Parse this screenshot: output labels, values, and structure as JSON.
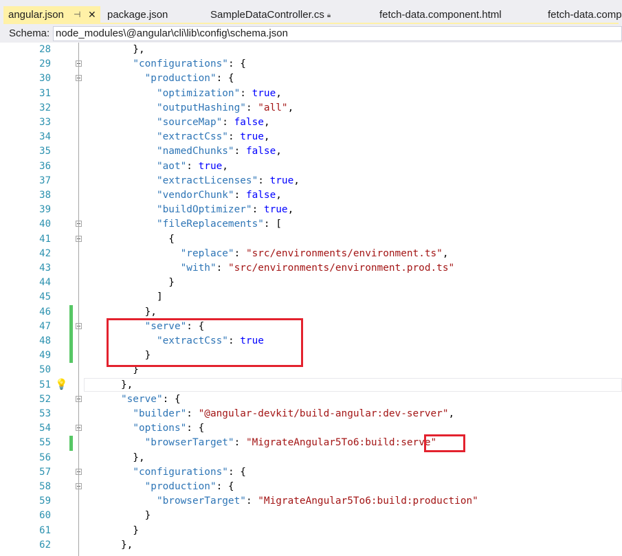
{
  "tabs": [
    {
      "label": "angular.json",
      "active": true
    },
    {
      "label": "package.json"
    },
    {
      "label": "SampleDataController.cs",
      "locked": true
    },
    {
      "label": "fetch-data.component.html"
    },
    {
      "label": "fetch-data.comp"
    }
  ],
  "tab_icons": {
    "pin": "pin-icon",
    "close": "close-icon",
    "lock": "lock-icon"
  },
  "schema": {
    "label": "Schema:",
    "value": "node_modules\\@angular\\cli\\lib\\config\\schema.json"
  },
  "colors": {
    "key": "#2e75b6",
    "string": "#a31515",
    "keyword": "#0000ff",
    "linenum": "#2b91af",
    "changed": "#57c765",
    "highlight": "#e3222e"
  },
  "lines": [
    {
      "n": "28",
      "tokens": [
        [
          "p",
          "        },"
        ]
      ]
    },
    {
      "n": "29",
      "fold": true,
      "tokens": [
        [
          "p",
          "        "
        ],
        [
          "k",
          "\"configurations\""
        ],
        [
          "p",
          ": {"
        ]
      ]
    },
    {
      "n": "30",
      "fold": true,
      "tokens": [
        [
          "p",
          "          "
        ],
        [
          "k",
          "\"production\""
        ],
        [
          "p",
          ": {"
        ]
      ]
    },
    {
      "n": "31",
      "tokens": [
        [
          "p",
          "            "
        ],
        [
          "k",
          "\"optimization\""
        ],
        [
          "p",
          ": "
        ],
        [
          "b",
          "true"
        ],
        [
          "p",
          ","
        ]
      ]
    },
    {
      "n": "32",
      "tokens": [
        [
          "p",
          "            "
        ],
        [
          "k",
          "\"outputHashing\""
        ],
        [
          "p",
          ": "
        ],
        [
          "s",
          "\"all\""
        ],
        [
          "p",
          ","
        ]
      ]
    },
    {
      "n": "33",
      "tokens": [
        [
          "p",
          "            "
        ],
        [
          "k",
          "\"sourceMap\""
        ],
        [
          "p",
          ": "
        ],
        [
          "b",
          "false"
        ],
        [
          "p",
          ","
        ]
      ]
    },
    {
      "n": "34",
      "tokens": [
        [
          "p",
          "            "
        ],
        [
          "k",
          "\"extractCss\""
        ],
        [
          "p",
          ": "
        ],
        [
          "b",
          "true"
        ],
        [
          "p",
          ","
        ]
      ]
    },
    {
      "n": "35",
      "tokens": [
        [
          "p",
          "            "
        ],
        [
          "k",
          "\"namedChunks\""
        ],
        [
          "p",
          ": "
        ],
        [
          "b",
          "false"
        ],
        [
          "p",
          ","
        ]
      ]
    },
    {
      "n": "36",
      "tokens": [
        [
          "p",
          "            "
        ],
        [
          "k",
          "\"aot\""
        ],
        [
          "p",
          ": "
        ],
        [
          "b",
          "true"
        ],
        [
          "p",
          ","
        ]
      ]
    },
    {
      "n": "37",
      "tokens": [
        [
          "p",
          "            "
        ],
        [
          "k",
          "\"extractLicenses\""
        ],
        [
          "p",
          ": "
        ],
        [
          "b",
          "true"
        ],
        [
          "p",
          ","
        ]
      ]
    },
    {
      "n": "38",
      "tokens": [
        [
          "p",
          "            "
        ],
        [
          "k",
          "\"vendorChunk\""
        ],
        [
          "p",
          ": "
        ],
        [
          "b",
          "false"
        ],
        [
          "p",
          ","
        ]
      ]
    },
    {
      "n": "39",
      "tokens": [
        [
          "p",
          "            "
        ],
        [
          "k",
          "\"buildOptimizer\""
        ],
        [
          "p",
          ": "
        ],
        [
          "b",
          "true"
        ],
        [
          "p",
          ","
        ]
      ]
    },
    {
      "n": "40",
      "fold": true,
      "tokens": [
        [
          "p",
          "            "
        ],
        [
          "k",
          "\"fileReplacements\""
        ],
        [
          "p",
          ": ["
        ]
      ]
    },
    {
      "n": "41",
      "fold": true,
      "tokens": [
        [
          "p",
          "              {"
        ]
      ]
    },
    {
      "n": "42",
      "tokens": [
        [
          "p",
          "                "
        ],
        [
          "k",
          "\"replace\""
        ],
        [
          "p",
          ": "
        ],
        [
          "s",
          "\"src/environments/environment.ts\""
        ],
        [
          "p",
          ","
        ]
      ]
    },
    {
      "n": "43",
      "tokens": [
        [
          "p",
          "                "
        ],
        [
          "k",
          "\"with\""
        ],
        [
          "p",
          ": "
        ],
        [
          "s",
          "\"src/environments/environment.prod.ts\""
        ]
      ]
    },
    {
      "n": "44",
      "tokens": [
        [
          "p",
          "              }"
        ]
      ]
    },
    {
      "n": "45",
      "tokens": [
        [
          "p",
          "            ]"
        ]
      ]
    },
    {
      "n": "46",
      "changed": true,
      "tokens": [
        [
          "p",
          "          },"
        ]
      ]
    },
    {
      "n": "47",
      "changed": true,
      "fold": true,
      "tokens": [
        [
          "p",
          "          "
        ],
        [
          "k",
          "\"serve\""
        ],
        [
          "p",
          ": {"
        ]
      ]
    },
    {
      "n": "48",
      "changed": true,
      "tokens": [
        [
          "p",
          "            "
        ],
        [
          "k",
          "\"extractCss\""
        ],
        [
          "p",
          ": "
        ],
        [
          "b",
          "true"
        ]
      ]
    },
    {
      "n": "49",
      "changed": true,
      "tokens": [
        [
          "p",
          "          }"
        ]
      ]
    },
    {
      "n": "50",
      "tokens": [
        [
          "p",
          "        }"
        ]
      ]
    },
    {
      "n": "51",
      "bulb": true,
      "tokens": [
        [
          "p",
          "      },"
        ]
      ]
    },
    {
      "n": "52",
      "fold": true,
      "tokens": [
        [
          "p",
          "      "
        ],
        [
          "k",
          "\"serve\""
        ],
        [
          "p",
          ": {"
        ]
      ]
    },
    {
      "n": "53",
      "tokens": [
        [
          "p",
          "        "
        ],
        [
          "k",
          "\"builder\""
        ],
        [
          "p",
          ": "
        ],
        [
          "s",
          "\"@angular-devkit/build-angular:dev-server\""
        ],
        [
          "p",
          ","
        ]
      ]
    },
    {
      "n": "54",
      "fold": true,
      "tokens": [
        [
          "p",
          "        "
        ],
        [
          "k",
          "\"options\""
        ],
        [
          "p",
          ": {"
        ]
      ]
    },
    {
      "n": "55",
      "changed": true,
      "tokens": [
        [
          "p",
          "          "
        ],
        [
          "k",
          "\"browserTarget\""
        ],
        [
          "p",
          ": "
        ],
        [
          "s",
          "\"MigrateAngular5To6:build:serve\""
        ]
      ]
    },
    {
      "n": "56",
      "tokens": [
        [
          "p",
          "        },"
        ]
      ]
    },
    {
      "n": "57",
      "fold": true,
      "tokens": [
        [
          "p",
          "        "
        ],
        [
          "k",
          "\"configurations\""
        ],
        [
          "p",
          ": {"
        ]
      ]
    },
    {
      "n": "58",
      "fold": true,
      "tokens": [
        [
          "p",
          "          "
        ],
        [
          "k",
          "\"production\""
        ],
        [
          "p",
          ": {"
        ]
      ]
    },
    {
      "n": "59",
      "tokens": [
        [
          "p",
          "            "
        ],
        [
          "k",
          "\"browserTarget\""
        ],
        [
          "p",
          ": "
        ],
        [
          "s",
          "\"MigrateAngular5To6:build:production\""
        ]
      ]
    },
    {
      "n": "60",
      "tokens": [
        [
          "p",
          "          }"
        ]
      ]
    },
    {
      "n": "61",
      "tokens": [
        [
          "p",
          "        }"
        ]
      ]
    },
    {
      "n": "62",
      "tokens": [
        [
          "p",
          "      },"
        ]
      ]
    }
  ]
}
